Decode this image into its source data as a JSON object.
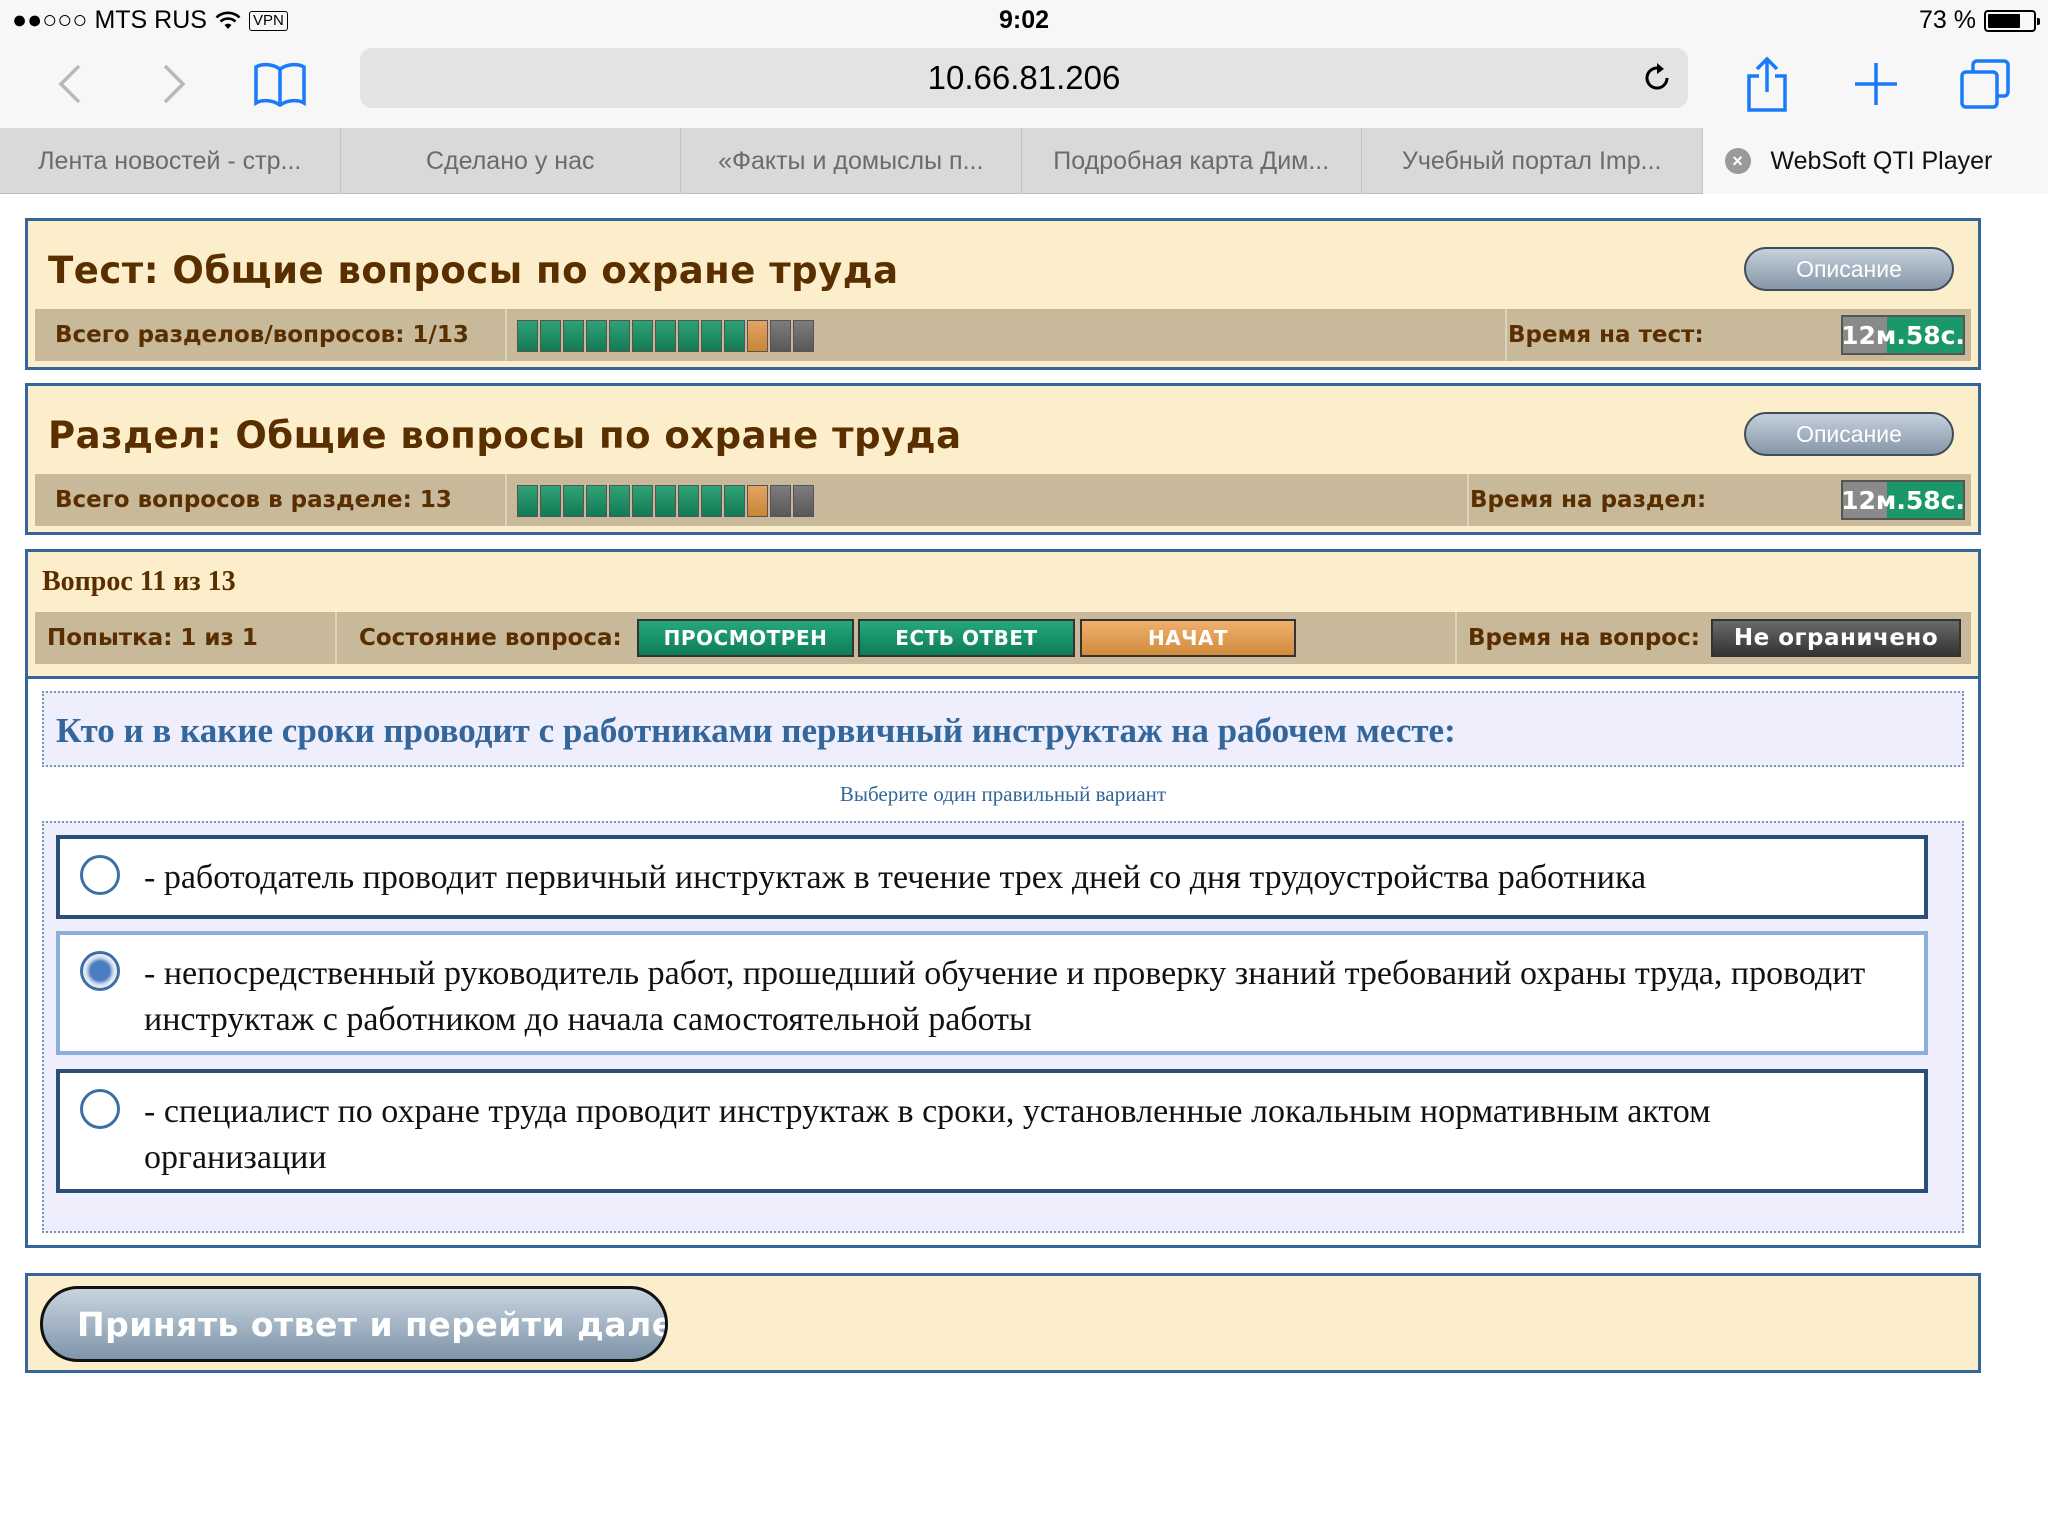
{
  "status_bar": {
    "carrier": "●●○○○ MTS RUS",
    "vpn": "VPN",
    "time": "9:02",
    "battery": "73 %",
    "battery_level": 0.73
  },
  "browser": {
    "url": "10.66.81.206",
    "tabs": [
      {
        "label": "Лента новостей - стр..."
      },
      {
        "label": "Сделано у нас"
      },
      {
        "label": "«Факты и домыслы п..."
      },
      {
        "label": "Подробная карта Дим..."
      },
      {
        "label": "Учебный портал Imp..."
      },
      {
        "label": "WebSoft QTI Player",
        "active": true
      }
    ]
  },
  "test": {
    "title": "Тест: Общие вопросы по охране труда",
    "description_button": "Описание",
    "count_label": "Всего разделов/вопросов: 1/13",
    "time_label": "Время на тест:",
    "timer": "12м.58с."
  },
  "section": {
    "title": "Раздел: Общие вопросы по охране труда",
    "description_button": "Описание",
    "count_label": "Всего вопросов в разделе: 13",
    "time_label": "Время на раздел:",
    "timer": "12м.58с."
  },
  "progress": {
    "total": 13,
    "done": 10,
    "current_index": 11
  },
  "question": {
    "number": "Вопрос 11 из 13",
    "attempt": "Попытка: 1 из 1",
    "state_label": "Состояние вопроса:",
    "badges": {
      "viewed": "ПРОСМОТРЕН",
      "answered": "ЕСТЬ ОТВЕТ",
      "started": "НАЧАТ"
    },
    "time_label": "Время на вопрос:",
    "time_value": "Не ограничено",
    "text": "Кто и в какие сроки проводит с работниками первичный инструктаж на рабочем месте:",
    "hint": "Выберите один правильный вариант",
    "answers": [
      {
        "text": "- работодатель проводит первичный инструктаж в течение трех дней со дня трудоустройства работника",
        "selected": false
      },
      {
        "text": "- непосредственный руководитель работ, прошедший обучение и проверку знаний требований охраны труда, проводит инструктаж с работником до начала самостоятельной работы",
        "selected": true
      },
      {
        "text": "- специалист по охране труда проводит инструктаж в сроки, установленные локальным нормативным актом организации",
        "selected": false
      }
    ]
  },
  "footer": {
    "submit_button": "Принять ответ и перейти далее"
  }
}
